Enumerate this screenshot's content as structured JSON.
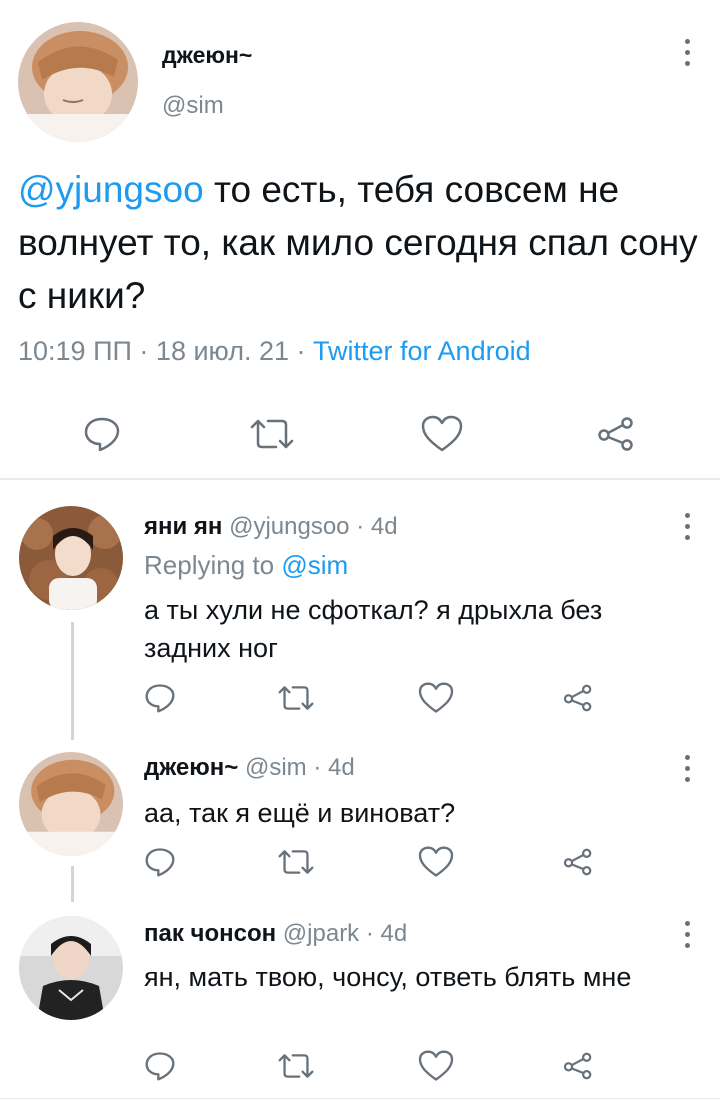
{
  "main_tweet": {
    "display_name": "джеюн~",
    "handle": "@sim",
    "mention": "@yjungsoo",
    "text": " то есть, тебя совсем не волнует то, как мило сегодня спал сону с ники?",
    "time": "10:19 ПП",
    "sep1": "·",
    "date": "18 июл. 21",
    "sep2": "·",
    "client": "Twitter for Android"
  },
  "replies": [
    {
      "display_name": "яни ян",
      "handle": "@yjungsoo",
      "meta": "· 4d",
      "replying_prefix": "Replying to",
      "replying_handle": "@sim",
      "text": "а ты хули не сфоткал? я дрыхла без задних ног"
    },
    {
      "display_name": "джеюн~",
      "handle": "@sim",
      "meta": "· 4d",
      "text": "аа, так я ещё и виноват?"
    },
    {
      "display_name": "пак чонсон",
      "handle": "@jpark",
      "meta": "· 4d",
      "text": "ян, мать твою, чонсу, ответь блять мне"
    }
  ],
  "icons": [
    "more-vertical-icon",
    "reply-icon",
    "retweet-icon",
    "like-icon",
    "share-icon"
  ],
  "colors": {
    "link": "#1d9bf0",
    "muted": "#7c8790",
    "icon": "#68717a",
    "thread": "#cfd5da"
  }
}
